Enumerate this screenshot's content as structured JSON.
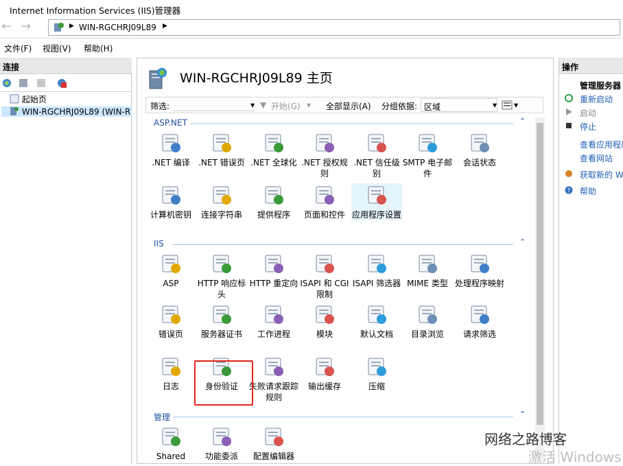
{
  "window": {
    "title": "Internet Information Services (IIS)管理器"
  },
  "address": {
    "path": "WIN-RGCHRJ09L89"
  },
  "menu": [
    "文件(F)",
    "视图(V)",
    "帮助(H)"
  ],
  "left": {
    "header": "连接",
    "tree": [
      "起始页",
      "WIN-RGCHRJ09L89 (WIN-R"
    ]
  },
  "center": {
    "title": "WIN-RGCHRJ09L89 主页",
    "filter": {
      "label": "筛选:",
      "start": "开始(G)",
      "show_all": "全部显示(A)",
      "group_by": "分组依据:",
      "group_value": "区域"
    },
    "sections": [
      {
        "name": "ASP.NET",
        "items": [
          ".NET 编译",
          ".NET 错误页",
          ".NET 全球化",
          ".NET 授权规则",
          ".NET 信任级别",
          "SMTP 电子邮件",
          "会话状态",
          "计算机密钥",
          "连接字符串",
          "提供程序",
          "页面和控件",
          "应用程序设置"
        ]
      },
      {
        "name": "IIS",
        "items": [
          "ASP",
          "HTTP 响应标头",
          "HTTP 重定向",
          "ISAPI 和 CGI 限制",
          "ISAPI 筛选器",
          "MIME 类型",
          "处理程序映射",
          "错误页",
          "服务器证书",
          "工作进程",
          "模块",
          "默认文档",
          "目录浏览",
          "请求筛选",
          "日志",
          "身份验证",
          "失败请求跟踪规则",
          "输出缓存",
          "压缩"
        ]
      },
      {
        "name": "管理",
        "items": [
          "Shared",
          "功能委派",
          "配置编辑器"
        ]
      }
    ]
  },
  "right": {
    "header": "操作",
    "group": "管理服务器",
    "actions": [
      "重新启动",
      "启动",
      "停止",
      "查看应用程序",
      "查看网站",
      "获取新的 W",
      "帮助"
    ]
  },
  "watermark": {
    "brand": "网络之路博客",
    "activate": "激活 Windows"
  },
  "colors": {
    "section": "#1f4e9e",
    "link": "#1f5fb5",
    "highlight_box": "#e0231b"
  }
}
